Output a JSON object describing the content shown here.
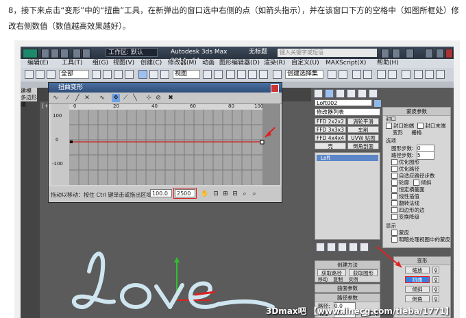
{
  "intro": {
    "text": "8，接下来点击“变形”中的“扭曲”工具，在新弹出的窗口选中右侧的点（如箭头指示），并在该窗口下方的空格中（如图所框处）修改右侧数值（数值越高效果越好）。"
  },
  "app": {
    "workspace": "工作区: 默认",
    "title": "Autodesk 3ds Max 2014 x64",
    "file": "无标题",
    "search_placeholder": "键入关键字或短语"
  },
  "menu": [
    "编辑(E)",
    "工具(T)",
    "组(G)",
    "视图(V)",
    "创建(C)",
    "修改器(M)",
    "动画",
    "图形编辑器(D)",
    "渲染(R)",
    "自定义(U)",
    "MAXScript(X)",
    "帮助(H)"
  ],
  "toolbar": {
    "filter": "全部",
    "coord": "视图",
    "selection_set": "创建选择集"
  },
  "side_tabs": [
    "建模",
    "多边形建"
  ],
  "viewport": {
    "label": "[+"
  },
  "curve_dialog": {
    "title": "扭曲变形",
    "ruler": [
      "0",
      "20",
      "40",
      "60",
      "80",
      "100"
    ],
    "y_labels": [
      "100",
      "0",
      "-100"
    ],
    "status": "拖动以移动：按住 Ctrl 键单击或拖出区域以选",
    "value1": "100.0",
    "value2": "2500"
  },
  "panel": {
    "object_name": "Loft002",
    "modifier_list": "修改器列表",
    "buttons": [
      "FFD 2x2x2",
      "涡轮平滑",
      "FFD 3x3x3",
      "车削",
      "FFD 4x4x4",
      "UVW 贴图",
      "壳",
      "倒角剖面"
    ],
    "stack_item": "Loft",
    "skin_params": {
      "header": "蒙皮参数",
      "cap_label": "封口",
      "cap_start": "封口始端",
      "cap_end": "封口末端",
      "morph": "变形",
      "grid": "栅格",
      "options": "选项",
      "shape_steps": "图形步数:",
      "path_steps": "路径步数:",
      "optimize_shapes": "优化图形",
      "optimize_path": "优化路径",
      "adaptive_path": "自适应路径步数",
      "contour": "轮廓",
      "banking": "倾斜",
      "constant_cross": "恒定横截面",
      "linear_interp": "线性插值",
      "flip_normals": "翻转法线",
      "quad_sides": "四边形的边",
      "transform_degrade": "变换降级",
      "display": "显示",
      "skin": "蒙皮",
      "skin_shaded": "明暗处理视图中的蒙皮",
      "shape_steps_val": "0",
      "path_steps_val": "5"
    },
    "creation": {
      "header": "创建方法",
      "get_path": "获取路径",
      "get_shape": "获取图形",
      "move": "移动",
      "copy": "复制",
      "instance": "实例"
    },
    "surface": {
      "header": "曲面参数"
    },
    "path_params": {
      "header": "路径参数",
      "path_label": "路径:",
      "path_val": "0.0",
      "snap_label": "捕捉:",
      "snap_val": "10.0",
      "enable": "启用"
    },
    "deform": {
      "header": "变形",
      "scale": "缩放",
      "twist": "扭曲",
      "teeter": "倾斜",
      "bevel": "倒角"
    }
  },
  "watermark": "3Dmax吧 【www.linecg.com/tieba/1771】",
  "colors": {
    "highlight": "#3a7fe0",
    "arrow": "#e02020",
    "curve": "#cc3030"
  }
}
